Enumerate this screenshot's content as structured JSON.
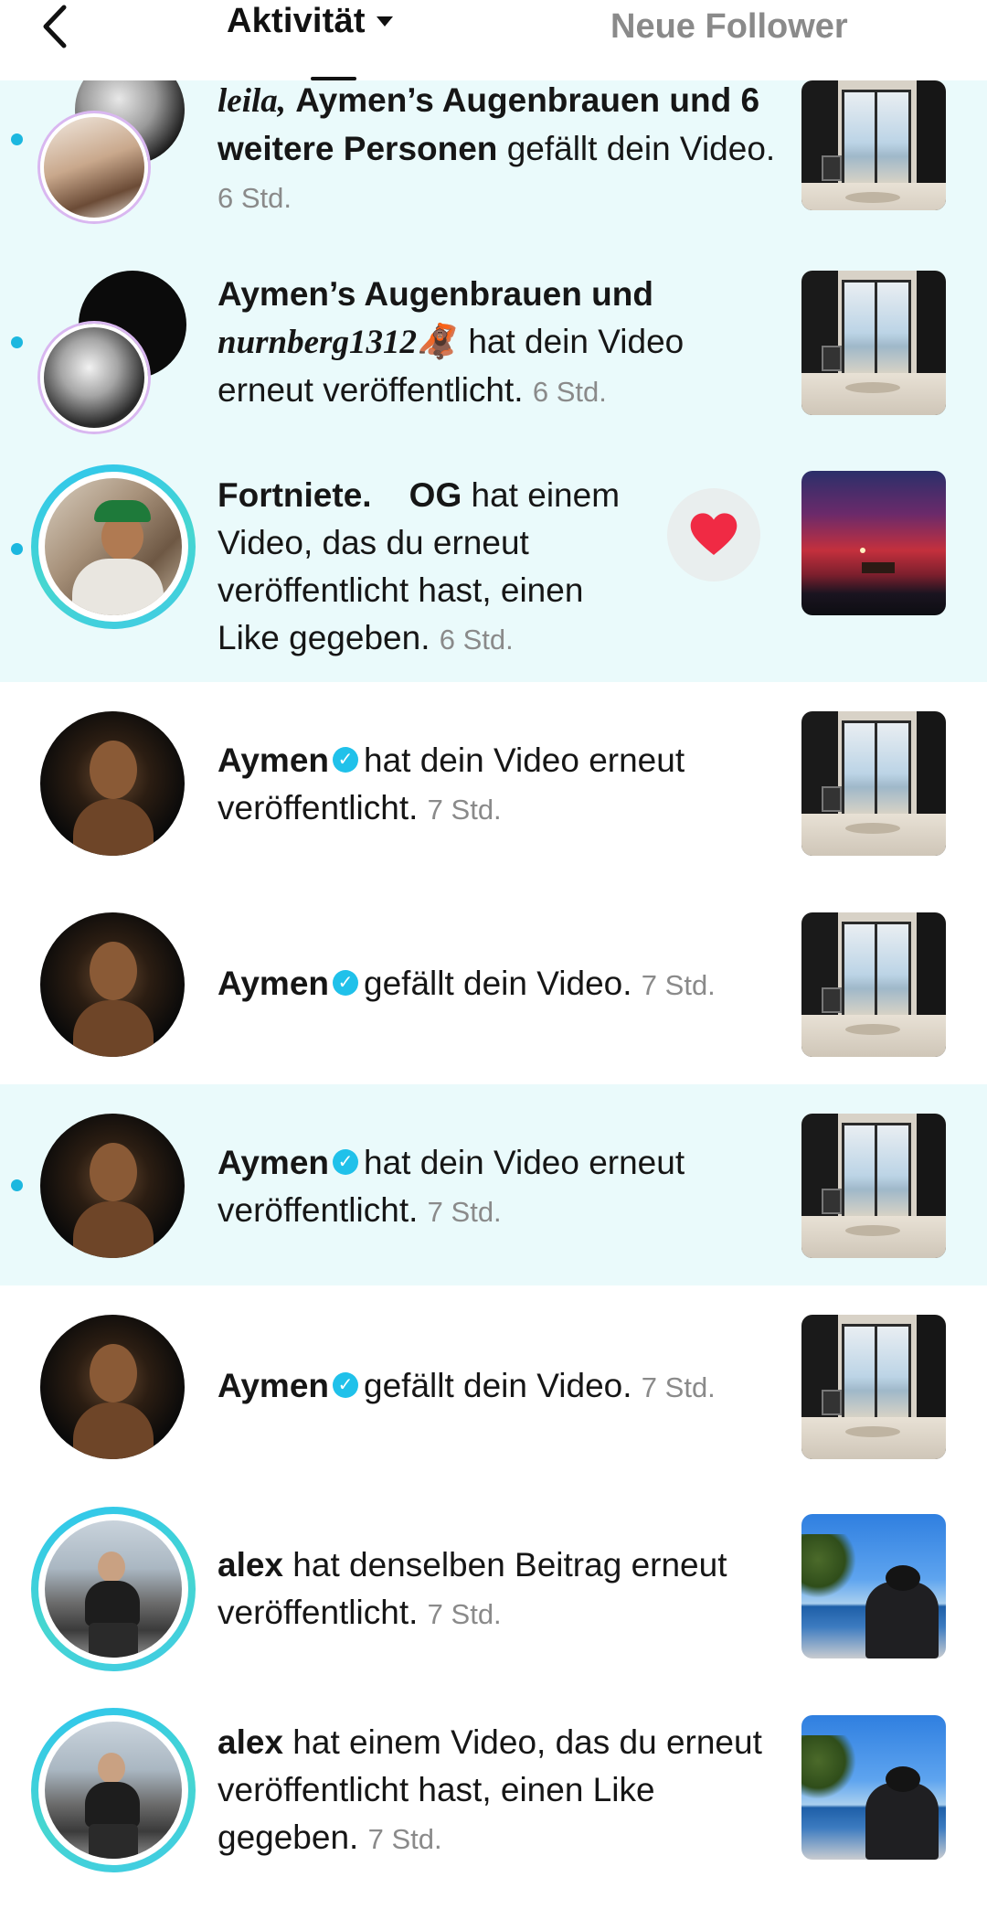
{
  "header": {
    "title": "Aktivität",
    "right_tab": "Neue Follower"
  },
  "notifications": [
    {
      "unread": true,
      "actor": "leila, Aymen’s Augenbrauen und 6 weitere Personen",
      "actor_a": "leila,",
      "actor_b": "Aymen’s Augenbrauen und 6 weitere Personen",
      "action": "gefällt dein Video.",
      "time": "6 Std.",
      "thumb": "room"
    },
    {
      "unread": true,
      "actor_a": "Aymen’s Augenbrauen und",
      "actor_b": "nurnberg1312",
      "emoji": "🦧",
      "action": "hat dein Video erneut veröffentlicht.",
      "time": "6 Std.",
      "thumb": "room"
    },
    {
      "unread": true,
      "actor": "Fortniete.    OG",
      "action": "hat einem Video, das du erneut veröffentlicht hast, einen Like gegeben.",
      "time": "6 Std.",
      "thumb": "sunset",
      "reaction_icon": "heart-icon"
    },
    {
      "unread": false,
      "actor": "Aymen",
      "verified": true,
      "action": "hat dein Video erneut veröffentlicht.",
      "time": "7 Std.",
      "thumb": "room"
    },
    {
      "unread": false,
      "actor": "Aymen",
      "verified": true,
      "action": "gefällt dein Video.",
      "time": "7 Std.",
      "thumb": "room"
    },
    {
      "unread": true,
      "actor": "Aymen",
      "verified": true,
      "action": "hat dein Video erneut veröffentlicht.",
      "time": "7 Std.",
      "thumb": "room"
    },
    {
      "unread": false,
      "actor": "Aymen",
      "verified": true,
      "action": "gefällt dein Video.",
      "time": "7 Std.",
      "thumb": "room"
    },
    {
      "unread": false,
      "actor": "alex",
      "action": "hat denselben Beitrag erneut veröffentlicht.",
      "time": "7 Std.",
      "thumb": "beach"
    },
    {
      "unread": false,
      "actor": "alex",
      "action": "hat einem Video, das du erneut veröffentlicht hast, einen Like gegeben.",
      "time": "7 Std.",
      "thumb": "beach"
    }
  ],
  "verified_mark": "✓",
  "colors": {
    "unread_bg": "#eafafb",
    "unread_dot": "#1cb7df",
    "story_ring": "#2ec5ef",
    "verified": "#20c1ea",
    "heart": "#f02a44"
  }
}
